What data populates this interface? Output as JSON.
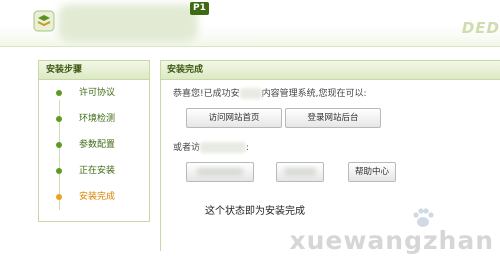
{
  "header": {
    "version_badge": "P1",
    "brand_mark": "DED",
    "colors": {
      "accent": "#3d6a12",
      "panel_border": "#c7d9a6"
    }
  },
  "sidebar": {
    "title": "安装步骤",
    "steps": [
      {
        "label": "许可协议",
        "state": "done"
      },
      {
        "label": "环境检测",
        "state": "done"
      },
      {
        "label": "参数配置",
        "state": "done"
      },
      {
        "label": "正在安装",
        "state": "done"
      },
      {
        "label": "安装完成",
        "state": "active"
      }
    ]
  },
  "main": {
    "title": "安装完成",
    "congrats_prefix": "恭喜您!已成功安",
    "congrats_suffix": "内容管理系统,您现在可以:",
    "buttons": {
      "visit_home": "访问网站首页",
      "login_admin": "登录网站后台"
    },
    "alt_prefix": "或者访",
    "alt_suffix": ":",
    "help_button": "帮助中心",
    "status_note": "这个状态即为安装完成"
  },
  "watermark": "xuewangzhan"
}
